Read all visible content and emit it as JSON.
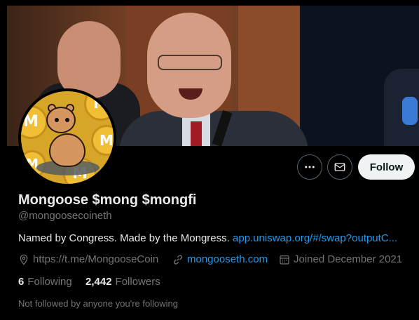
{
  "profile": {
    "display_name": "Mongoose $mong $mongfi",
    "handle": "@mongoosecoineth",
    "bio_text": "Named by Congress. Made by the Mongress.",
    "bio_link": "app.uniswap.org/#/swap?outputC...",
    "website": "https://t.me/MongooseCoin",
    "site_link": "mongooseth.com",
    "joined": "Joined December 2021",
    "avatar_coin_letter": "M"
  },
  "actions": {
    "follow_label": "Follow",
    "more_icon": "more-icon",
    "message_icon": "mail-icon"
  },
  "stats": {
    "following_count": "6",
    "following_label": "Following",
    "followers_count": "2,442",
    "followers_label": "Followers"
  },
  "footer": {
    "not_followed": "Not followed by anyone you're following"
  },
  "colors": {
    "background": "#000000",
    "text_primary": "#e7e9ea",
    "text_secondary": "#71767b",
    "link": "#1d9bf0",
    "follow_bg": "#eff3f4"
  }
}
